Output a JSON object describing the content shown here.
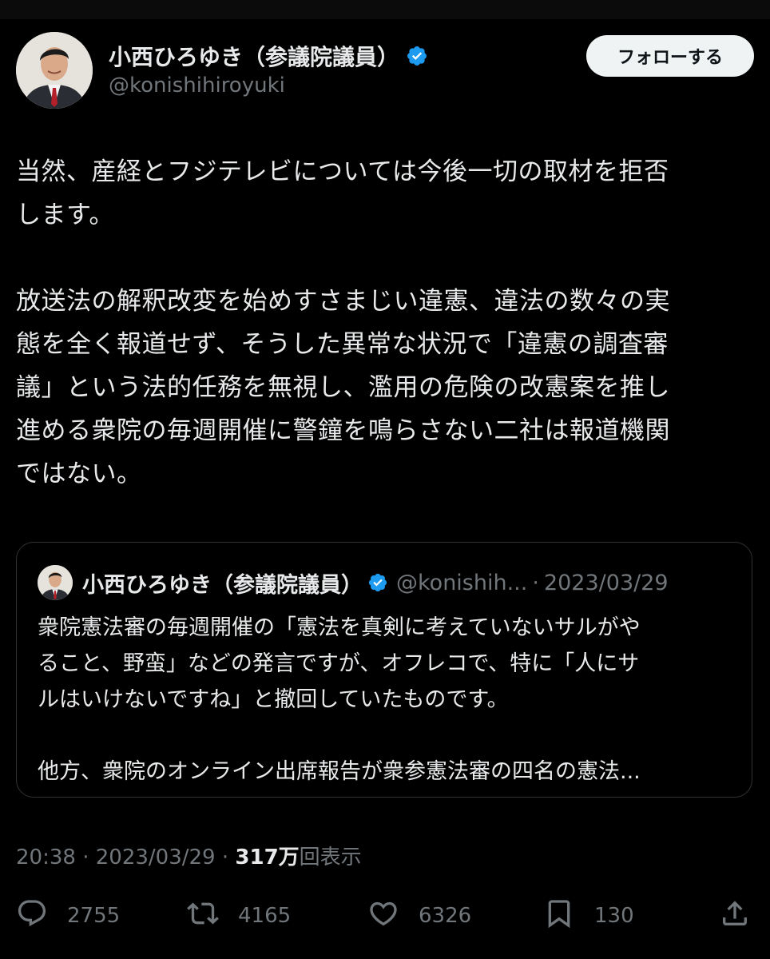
{
  "author": {
    "display_name": "小西ひろゆき（参議院議員）",
    "handle": "@konishihiroyuki",
    "verified": true
  },
  "follow_button": {
    "label": "フォローする"
  },
  "tweet": {
    "paragraphs": [
      "当然、産経とフジテレビについては今後一切の取材を拒否\nします。",
      "放送法の解釈改変を始めすさまじい違憲、違法の数々の実\n態を全く報道せず、そうした異常な状況で「違憲の調査審\n議」という法的任務を無視し、濫用の危険の改憲案を推し\n進める衆院の毎週開催に警鐘を鳴らさない二社は報道機関\nではない。"
    ]
  },
  "quote": {
    "display_name": "小西ひろゆき（参議院議員）",
    "handle": "@konishih...",
    "separator": "·",
    "date": "2023/03/29",
    "paragraphs": [
      "衆院憲法審の毎週開催の「憲法を真剣に考えていないサルがや\nること、野蛮」などの発言ですが、オフレコで、特に「人にサ\nルはいけないですね」と撤回していたものです。",
      "他方、衆院のオンライン出席報告が衆参憲法審の四名の憲法..."
    ]
  },
  "meta": {
    "time": "20:38",
    "separator": "·",
    "date": "2023/03/29",
    "views_count": "317万",
    "views_label": "回表示"
  },
  "actions": {
    "replies": "2755",
    "retweets": "4165",
    "likes": "6326",
    "bookmarks": "130"
  },
  "colors": {
    "background": "#000000",
    "text_primary": "#e7e9ea",
    "text_secondary": "#71767b",
    "border": "#2f3336",
    "verified_blue": "#1d9bf0",
    "button_bg": "#eff3f4"
  },
  "icons": {
    "verified": "verified-badge-icon",
    "reply": "reply-icon",
    "retweet": "retweet-icon",
    "like": "heart-icon",
    "bookmark": "bookmark-icon",
    "share": "share-icon"
  }
}
